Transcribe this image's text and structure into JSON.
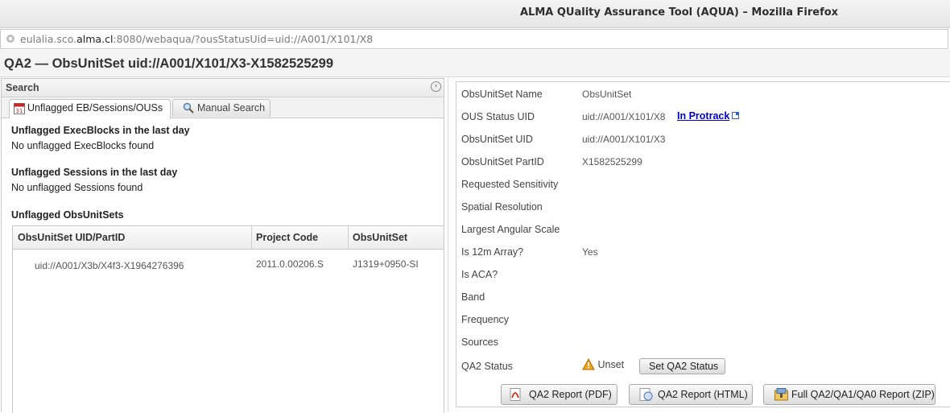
{
  "window": {
    "title": "ALMA QUality Assurance Tool (AQUA) – Mozilla Firefox"
  },
  "address_bar": {
    "url_prefix": "eulalia.sco.",
    "url_domain": "alma.cl",
    "url_suffix": ":8080/webaqua/?ousStatusUid=uid://A001/X101/X8"
  },
  "page": {
    "title": "QA2 — ObsUnitSet uid://A001/X101/X3-X1582525299"
  },
  "search_panel": {
    "header": "Search",
    "collapse_glyph": "‹",
    "tabs": [
      {
        "label": "Unflagged EB/Sessions/OUSs",
        "icon": "calendar-icon"
      },
      {
        "label": "Manual Search",
        "icon": "magnifier-icon"
      }
    ],
    "execblocks_heading": "Unflagged ExecBlocks in the last day",
    "execblocks_empty": "No unflagged ExecBlocks found",
    "sessions_heading": "Unflagged Sessions in the last day",
    "sessions_empty": "No unflagged Sessions found",
    "ous_heading": "Unflagged ObsUnitSets",
    "table": {
      "columns": [
        "ObsUnitSet UID/PartID",
        "Project Code",
        "ObsUnitSet"
      ],
      "rows": [
        {
          "uid": "uid://A001/X3b/X4f3-X1964276396",
          "project_code": "2011.0.00206.S",
          "obsunitset": "J1319+0950-SI"
        }
      ]
    }
  },
  "details": {
    "fields": [
      {
        "label": "ObsUnitSet Name",
        "value": "ObsUnitSet"
      },
      {
        "label": "OUS Status UID",
        "value": "uid://A001/X101/X8"
      },
      {
        "label": "ObsUnitSet UID",
        "value": "uid://A001/X101/X3"
      },
      {
        "label": "ObsUnitSet PartID",
        "value": "X1582525299"
      },
      {
        "label": "Requested Sensitivity",
        "value": ""
      },
      {
        "label": "Spatial Resolution",
        "value": ""
      },
      {
        "label": "Largest Angular Scale",
        "value": ""
      },
      {
        "label": "Is 12m Array?",
        "value": "Yes"
      },
      {
        "label": "Is ACA?",
        "value": ""
      },
      {
        "label": "Band",
        "value": ""
      },
      {
        "label": "Frequency",
        "value": ""
      },
      {
        "label": "Sources",
        "value": ""
      },
      {
        "label": "QA2 Status",
        "value": "Unset"
      }
    ],
    "protrack_link": "In Protrack",
    "set_status_button": "Set QA2 Status",
    "report_buttons": {
      "pdf": "QA2 Report (PDF)",
      "html": "QA2 Report (HTML)",
      "zip": "Full QA2/QA1/QA0 Report (ZIP)"
    }
  },
  "colors": {
    "link": "#0000cc",
    "warning": "#e8a317",
    "pdf_red": "#cc2b1f"
  }
}
